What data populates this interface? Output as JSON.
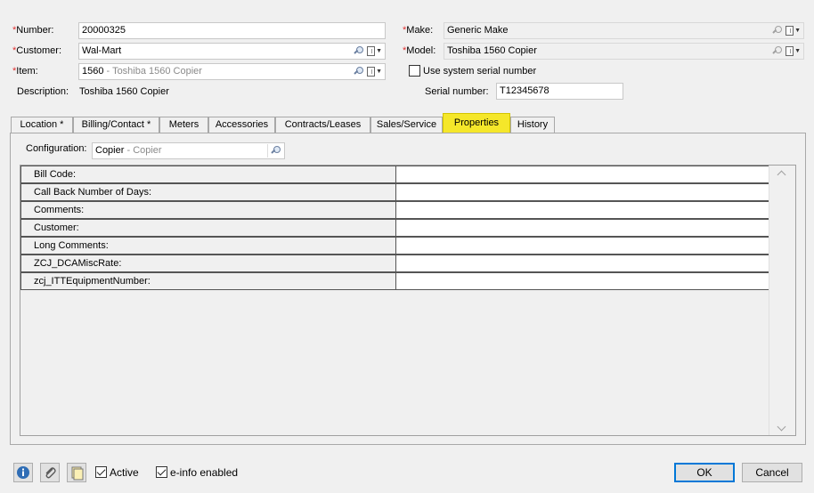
{
  "header": {
    "number": {
      "label": "Number:",
      "value": "20000325"
    },
    "customer": {
      "label": "Customer:",
      "value": "Wal-Mart"
    },
    "item": {
      "label": "Item:",
      "code": "1560",
      "separator": " - ",
      "desc": "Toshiba 1560 Copier"
    },
    "description": {
      "label": "Description:",
      "value": "Toshiba 1560 Copier"
    },
    "make": {
      "label": "Make:",
      "value": "Generic Make"
    },
    "model": {
      "label": "Model:",
      "value": "Toshiba 1560 Copier"
    },
    "use_system_serial": {
      "label": "Use system serial number",
      "checked": false
    },
    "serial": {
      "label": "Serial number:",
      "value": "T12345678"
    },
    "required_mark": "*"
  },
  "tabs": [
    {
      "label": "Location *",
      "active": false
    },
    {
      "label": "Billing/Contact *",
      "active": false
    },
    {
      "label": "Meters",
      "active": false
    },
    {
      "label": "Accessories",
      "active": false
    },
    {
      "label": "Contracts/Leases",
      "active": false
    },
    {
      "label": "Sales/Service",
      "active": false
    },
    {
      "label": "Properties",
      "active": true
    },
    {
      "label": "History",
      "active": false
    }
  ],
  "properties": {
    "configuration": {
      "label": "Configuration:",
      "code": "Copier",
      "separator": " - ",
      "desc": "Copier"
    },
    "rows": [
      {
        "name": "Bill Code:",
        "value": ""
      },
      {
        "name": "Call Back Number of Days:",
        "value": ""
      },
      {
        "name": "Comments:",
        "value": ""
      },
      {
        "name": "Customer:",
        "value": ""
      },
      {
        "name": "Long Comments:",
        "value": ""
      },
      {
        "name": "ZCJ_DCAMiscRate:",
        "value": ""
      },
      {
        "name": "zcj_ITTEquipmentNumber:",
        "value": ""
      }
    ]
  },
  "footer": {
    "active": {
      "label": "Active",
      "checked": true
    },
    "einfo": {
      "label": "e-info enabled",
      "checked": true
    },
    "ok_label": "OK",
    "cancel_label": "Cancel"
  },
  "colors": {
    "active_tab": "#f5e72a",
    "required": "#e03030",
    "ok_border": "#0078d7"
  },
  "icons": [
    "info-icon",
    "paperclip-icon",
    "notes-icon",
    "lookup-icon",
    "document-menu-icon"
  ]
}
